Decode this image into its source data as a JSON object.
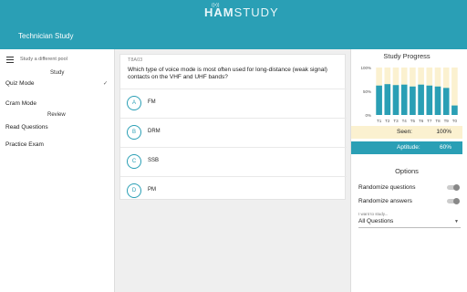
{
  "header": {
    "logo_sup": "((•))",
    "logo_bold": "HAM",
    "logo_light": "STUDY",
    "title": "Technician Study"
  },
  "sidebar": {
    "pool_placeholder": "Study a different pool",
    "study_heading": "Study",
    "review_heading": "Review",
    "items": [
      {
        "label": "Quiz Mode",
        "selected": true
      },
      {
        "label": "Cram Mode",
        "selected": false
      },
      {
        "label": "Read Questions",
        "selected": false
      },
      {
        "label": "Practice Exam",
        "selected": false
      }
    ],
    "check_mark": "✓"
  },
  "question": {
    "id": "T8A03",
    "text": "Which type of voice mode is most often used for long-distance (weak signal) contacts on the VHF and UHF bands?",
    "answers": [
      {
        "letter": "A",
        "text": "FM"
      },
      {
        "letter": "B",
        "text": "DRM"
      },
      {
        "letter": "C",
        "text": "SSB"
      },
      {
        "letter": "D",
        "text": "PM"
      }
    ]
  },
  "progress": {
    "title": "Study Progress",
    "seen_label": "Seen:",
    "seen_value": "100%",
    "aptitude_label": "Aptitude:",
    "aptitude_value": "60%"
  },
  "chart_data": {
    "type": "bar",
    "categories": [
      "T1",
      "T2",
      "T3",
      "T4",
      "T5",
      "T6",
      "T7",
      "T8",
      "T9",
      "T0"
    ],
    "series": [
      {
        "values": [
          100,
          100,
          100,
          100,
          100,
          100,
          100,
          100,
          100,
          100
        ],
        "color": "#fbf1d0"
      },
      {
        "values": [
          62,
          65,
          63,
          64,
          60,
          64,
          62,
          60,
          57,
          20
        ],
        "color": "#2a9fb5"
      }
    ],
    "y_ticks": [
      "100%",
      "50%",
      "0%"
    ],
    "ylim": [
      0,
      100
    ]
  },
  "options": {
    "title": "Options",
    "randomize_questions": "Randomize questions",
    "randomize_answers": "Randomize answers",
    "study_label": "I want to study...",
    "study_value": "All Questions",
    "caret": "▼"
  },
  "colors": {
    "accent": "#2a9fb5",
    "seen_bg": "#fbf1d0"
  }
}
